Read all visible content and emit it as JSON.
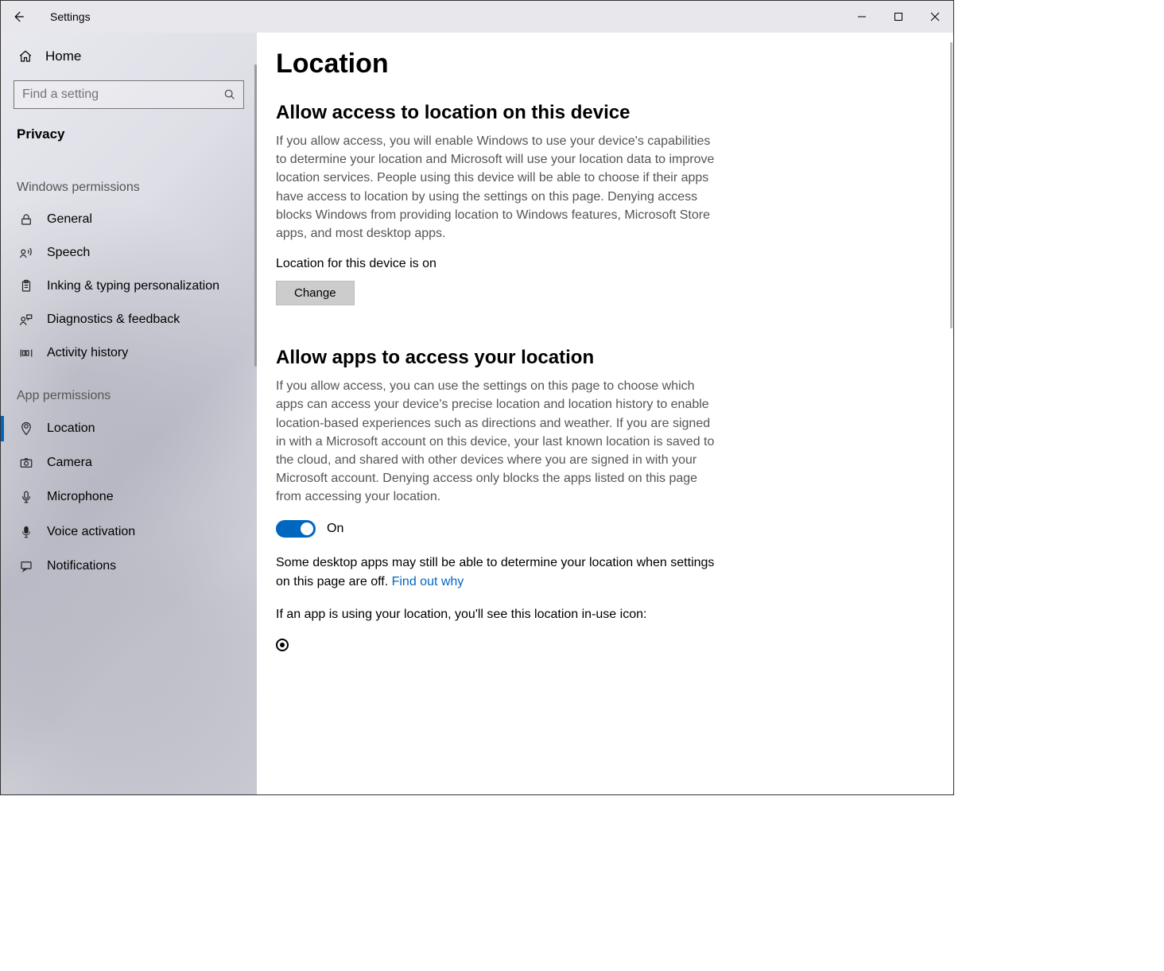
{
  "titlebar": {
    "title": "Settings"
  },
  "sidebar": {
    "home": "Home",
    "search_placeholder": "Find a setting",
    "category": "Privacy",
    "groups": [
      {
        "label": "Windows permissions",
        "items": [
          {
            "id": "general",
            "icon": "lock-icon",
            "label": "General"
          },
          {
            "id": "speech",
            "icon": "speech-icon",
            "label": "Speech"
          },
          {
            "id": "inking",
            "icon": "clipboard-icon",
            "label": "Inking & typing personalization"
          },
          {
            "id": "diagnostics",
            "icon": "feedback-icon",
            "label": "Diagnostics & feedback"
          },
          {
            "id": "activity",
            "icon": "activity-icon",
            "label": "Activity history"
          }
        ]
      },
      {
        "label": "App permissions",
        "items": [
          {
            "id": "location",
            "icon": "location-icon",
            "label": "Location",
            "active": true
          },
          {
            "id": "camera",
            "icon": "camera-icon",
            "label": "Camera"
          },
          {
            "id": "microphone",
            "icon": "microphone-icon",
            "label": "Microphone"
          },
          {
            "id": "voice",
            "icon": "voice-icon",
            "label": "Voice activation"
          },
          {
            "id": "notifications",
            "icon": "notifications-icon",
            "label": "Notifications"
          }
        ]
      }
    ]
  },
  "page": {
    "title": "Location",
    "section1": {
      "heading": "Allow access to location on this device",
      "desc": "If you allow access, you will enable Windows to use your device's capabilities to determine your location and Microsoft will use your location data to improve location services. People using this device will be able to choose if their apps have access to location by using the settings on this page. Denying access blocks Windows from providing location to Windows features, Microsoft Store apps, and most desktop apps.",
      "status": "Location for this device is on",
      "change_btn": "Change"
    },
    "section2": {
      "heading": "Allow apps to access your location",
      "desc": "If you allow access, you can use the settings on this page to choose which apps can access your device's precise location and location history to enable location-based experiences such as directions and weather. If you are signed in with a Microsoft account on this device, your last known location is saved to the cloud, and shared with other devices where you are signed in with your Microsoft account. Denying access only blocks the apps listed on this page from accessing your location.",
      "toggle_state": "On",
      "note_prefix": "Some desktop apps may still be able to determine your location when settings on this page are off. ",
      "note_link": "Find out why",
      "inuse_text": "If an app is using your location, you'll see this location in-use icon:"
    }
  }
}
